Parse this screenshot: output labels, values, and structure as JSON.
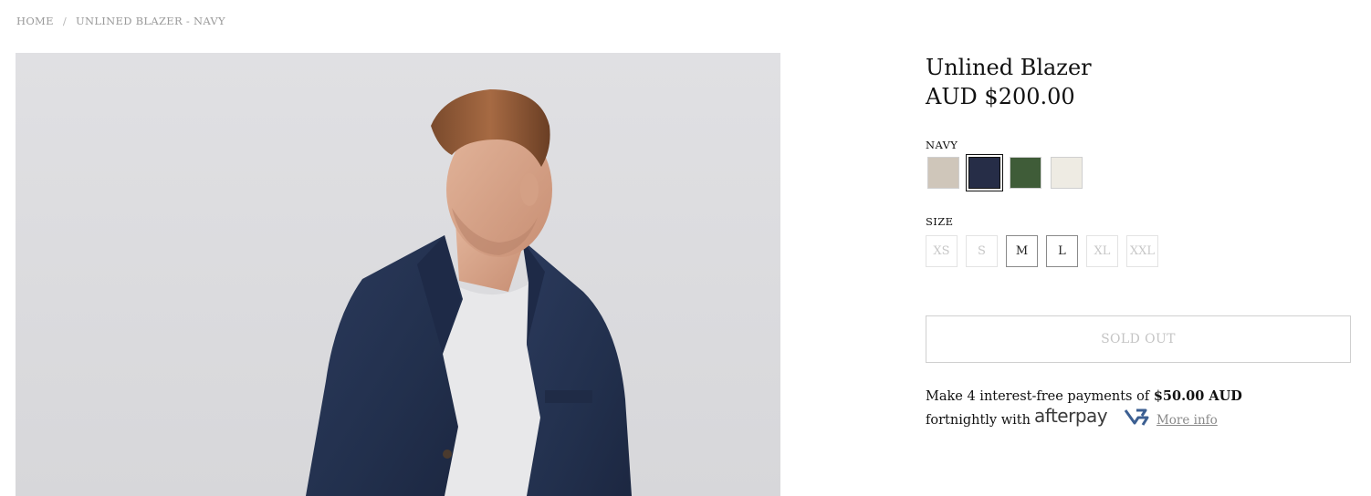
{
  "breadcrumb": {
    "home": "HOME",
    "separator": "/",
    "current": "UNLINED BLAZER - NAVY"
  },
  "product": {
    "title": "Unlined Blazer",
    "price": "AUD $200.00",
    "image_alt": "Model wearing navy unlined blazer"
  },
  "color": {
    "selected_label": "NAVY",
    "swatches": [
      {
        "name": "oatmeal",
        "hex": "#cfc6ba"
      },
      {
        "name": "navy",
        "hex": "#262d47",
        "selected": true
      },
      {
        "name": "green",
        "hex": "#3f5c38"
      },
      {
        "name": "ecru",
        "hex": "#eeebe3"
      }
    ]
  },
  "size": {
    "label": "SIZE",
    "options": [
      {
        "label": "XS",
        "available": false
      },
      {
        "label": "S",
        "available": false
      },
      {
        "label": "M",
        "available": true
      },
      {
        "label": "L",
        "available": true
      },
      {
        "label": "XL",
        "available": false
      },
      {
        "label": "XXL",
        "available": false
      }
    ]
  },
  "cta": {
    "sold_out_label": "SOLD OUT"
  },
  "afterpay": {
    "line1_prefix": "Make 4 interest-free payments of ",
    "amount": "$50.00 AUD",
    "line2_prefix": "fortnightly with",
    "brand": "afterpay",
    "more_info": "More info"
  }
}
